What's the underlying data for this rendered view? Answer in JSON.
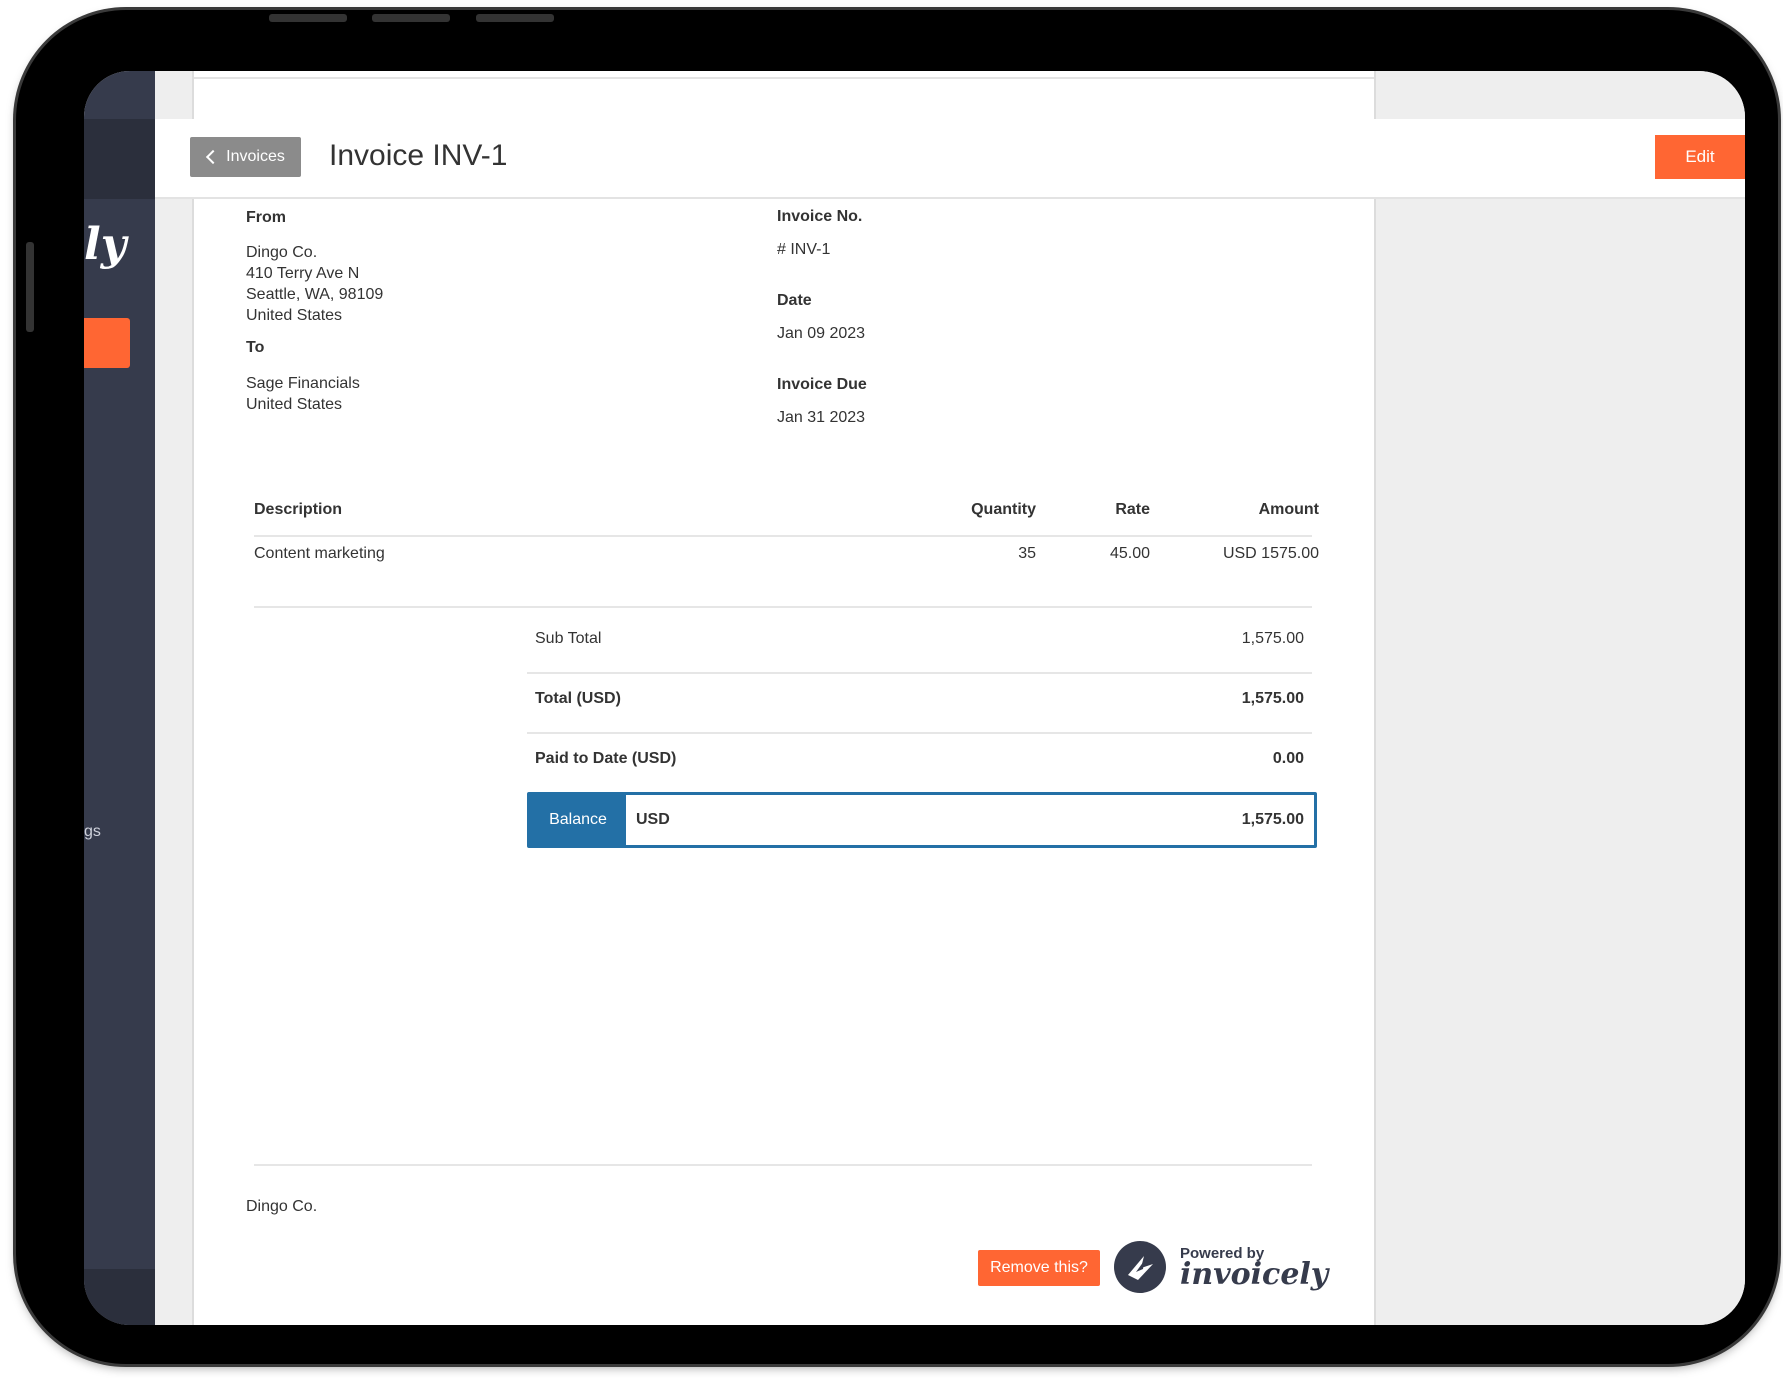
{
  "header": {
    "back_label": "Invoices",
    "title": "Invoice INV-1",
    "edit_label": "Edit"
  },
  "sidebar": {
    "logo_fragment": "ly",
    "nav_fragment": "gs"
  },
  "invoice": {
    "from_label": "From",
    "from_lines": [
      "Dingo Co.",
      "410 Terry Ave N",
      "Seattle, WA, 98109",
      "United States"
    ],
    "to_label": "To",
    "to_lines": [
      "Sage Financials",
      "United States"
    ],
    "invoice_no_label": "Invoice No.",
    "invoice_no": "# INV-1",
    "date_label": "Date",
    "date": "Jan 09 2023",
    "due_label": "Invoice Due",
    "due": "Jan 31 2023"
  },
  "items": {
    "headers": [
      "Description",
      "Quantity",
      "Rate",
      "Amount"
    ],
    "rows": [
      {
        "description": "Content marketing",
        "quantity": "35",
        "rate": "45.00",
        "amount": "USD 1575.00"
      }
    ]
  },
  "summary": {
    "subtotal_label": "Sub Total",
    "subtotal": "1,575.00",
    "total_label": "Total (USD)",
    "total": "1,575.00",
    "paid_label": "Paid to Date (USD)",
    "paid": "0.00",
    "balance_label": "Balance",
    "balance_currency": "USD",
    "balance": "1,575.00"
  },
  "footer": {
    "company": "Dingo Co.",
    "remove_label": "Remove this?",
    "powered_by": "Powered by",
    "brand": "invoicely"
  },
  "colors": {
    "accent": "#ff6633",
    "balance_blue": "#2370a6",
    "sidebar": "#363b4c"
  }
}
